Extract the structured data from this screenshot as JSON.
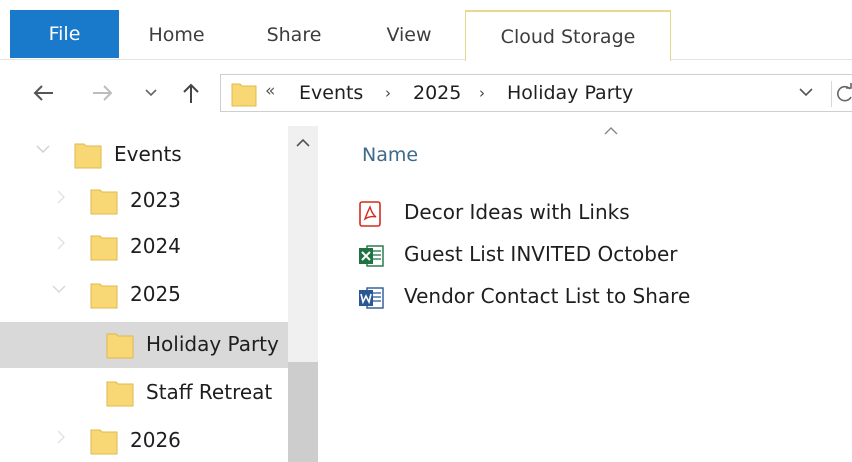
{
  "ribbon": {
    "tabs": [
      {
        "label": "File",
        "active": false
      },
      {
        "label": "Home",
        "active": false
      },
      {
        "label": "Share",
        "active": false
      },
      {
        "label": "View",
        "active": false
      },
      {
        "label": "Cloud Storage",
        "active": true
      }
    ]
  },
  "address": {
    "overflow": "«",
    "crumbs": [
      "Events",
      "2025",
      "Holiday Party"
    ],
    "separator": "›"
  },
  "nav_tree": {
    "items": [
      {
        "label": "Events",
        "expanded": true,
        "selected": false
      },
      {
        "label": "2023",
        "expanded": false,
        "selected": false
      },
      {
        "label": "2024",
        "expanded": false,
        "selected": false
      },
      {
        "label": "2025",
        "expanded": true,
        "selected": false
      },
      {
        "label": "Holiday Party",
        "expanded": false,
        "selected": true
      },
      {
        "label": "Staff Retreat",
        "expanded": false,
        "selected": false
      },
      {
        "label": "2026",
        "expanded": false,
        "selected": false
      }
    ]
  },
  "content": {
    "column_header": "Name",
    "sort": "ascending",
    "files": [
      {
        "name": "Decor Ideas with Links",
        "type": "pdf-icon"
      },
      {
        "name": "Guest List INVITED October",
        "type": "excel-icon"
      },
      {
        "name": "Vendor Contact List to Share",
        "type": "word-icon"
      }
    ]
  },
  "colors": {
    "file_tab": "#1979ca",
    "folder": "#f8d775",
    "selection": "#d9d9d9",
    "pdf": "#d52b1e",
    "excel": "#1f7244",
    "word": "#2b5797"
  }
}
